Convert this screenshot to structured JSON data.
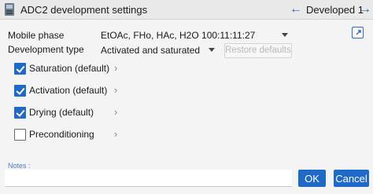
{
  "titlebar": {
    "title": "ADC2 development settings",
    "nav_prev_icon": "←",
    "nav_next_icon": "→",
    "current_label": "Developed 1"
  },
  "form": {
    "mobile_phase_label": "Mobile phase",
    "mobile_phase_value": "EtOAc, FHo, HAc, H2O 100:11:11:27",
    "development_type_label": "Development type",
    "development_type_value": "Activated and saturated",
    "restore_defaults_label": "Restore defaults",
    "external_link_icon": "open-external-icon"
  },
  "steps": [
    {
      "label": "Saturation (default)",
      "checked": true
    },
    {
      "label": "Activation (default)",
      "checked": true
    },
    {
      "label": "Drying (default)",
      "checked": true
    },
    {
      "label": "Preconditioning",
      "checked": false
    }
  ],
  "chevron": "›",
  "notes": {
    "label": "Notes :",
    "value": ""
  },
  "buttons": {
    "ok": "OK",
    "cancel": "Cancel"
  },
  "colors": {
    "accent": "#1f69c9",
    "nav_arrow": "#2a5fb0"
  }
}
